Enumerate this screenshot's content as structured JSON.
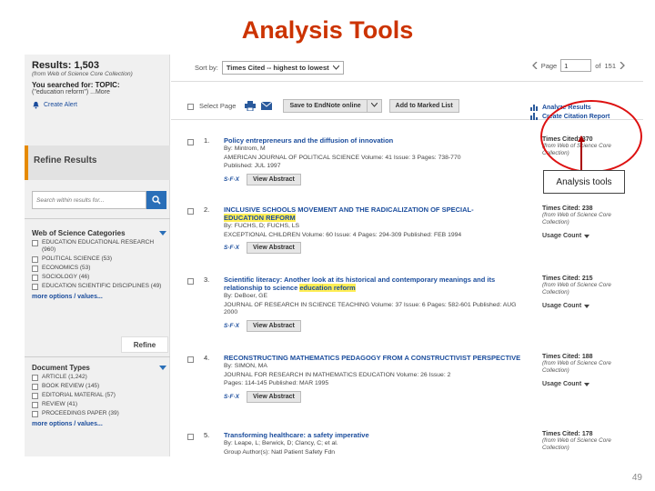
{
  "slide": {
    "title": "Analysis Tools",
    "page_number": "49"
  },
  "sidebar": {
    "results_title": "Results: 1,503",
    "results_note": "(from Web of Science Core Collection)",
    "searched_label": "You searched for: TOPIC:",
    "searched_query": "(\"education reform\") ...More",
    "create_alert": "Create Alert",
    "refine_title": "Refine Results",
    "search_placeholder": "Search within results for...",
    "categories": {
      "title": "Web of Science Categories",
      "items": [
        "EDUCATION EDUCATIONAL RESEARCH (960)",
        "POLITICAL SCIENCE (53)",
        "ECONOMICS (53)",
        "SOCIOLOGY (46)",
        "EDUCATION SCIENTIFIC DISCIPLINES (49)"
      ],
      "more": "more options / values...",
      "refine": "Refine"
    },
    "doc_types": {
      "title": "Document Types",
      "items": [
        "ARTICLE (1,242)",
        "BOOK REVIEW (145)",
        "EDITORIAL MATERIAL (57)",
        "REVIEW (41)",
        "PROCEEDINGS PAPER (39)"
      ],
      "more": "more options / values..."
    }
  },
  "sortbar": {
    "label": "Sort by:",
    "value": "Times Cited -- highest to lowest",
    "page_label": "Page",
    "page_value": "1",
    "of_label": "of",
    "total_pages": "151"
  },
  "toolbar": {
    "select_page": "Select Page",
    "save_endnote": "Save to EndNote online",
    "add_marked": "Add to Marked List",
    "analyze": "Analyze Results",
    "citation_report": "Create Citation Report"
  },
  "records": [
    {
      "num": "1.",
      "title_parts": [
        "Policy entrepreneurs and the diffusion of innovation"
      ],
      "hl_index": -1,
      "by": "By: Mintrom, M",
      "journal": "AMERICAN JOURNAL OF POLITICAL SCIENCE   Volume: 41   Issue: 3   Pages: 738-770",
      "published": "Published: JUL 1997",
      "times_cited": "Times Cited: 370",
      "tc_note": "(from Web of Science Core Collection)"
    },
    {
      "num": "2.",
      "title_parts": [
        "INCLUSIVE SCHOOLS MOVEMENT AND THE RADICALIZATION OF SPECIAL-",
        "EDUCATION REFORM"
      ],
      "hl_index": 1,
      "by": "By: FUCHS, D; FUCHS, LS",
      "journal": "EXCEPTIONAL CHILDREN   Volume: 60   Issue: 4   Pages: 294-309   Published: FEB 1994",
      "published": "",
      "times_cited": "Times Cited: 238",
      "tc_note": "(from Web of Science Core Collection)",
      "usage": "Usage Count"
    },
    {
      "num": "3.",
      "title_parts": [
        "Scientific literacy: Another look at its historical and contemporary meanings and its relationship to science ",
        "education reform"
      ],
      "hl_index": 1,
      "by": "By: DeBoer, GE",
      "journal": "JOURNAL OF RESEARCH IN SCIENCE TEACHING   Volume: 37   Issue: 6   Pages: 582-601   Published: AUG 2000",
      "published": "",
      "times_cited": "Times Cited: 215",
      "tc_note": "(from Web of Science Core Collection)",
      "usage": "Usage Count"
    },
    {
      "num": "4.",
      "title_parts": [
        "RECONSTRUCTING MATHEMATICS PEDAGOGY FROM A CONSTRUCTIVIST PERSPECTIVE"
      ],
      "hl_index": -1,
      "by": "By: SIMON, MA",
      "journal": "JOURNAL FOR RESEARCH IN MATHEMATICS EDUCATION   Volume: 26   Issue: 2",
      "published": "Pages: 114-145   Published: MAR 1995",
      "times_cited": "Times Cited: 188",
      "tc_note": "(from Web of Science Core Collection)",
      "usage": "Usage Count"
    },
    {
      "num": "5.",
      "title_parts": [
        "Transforming healthcare: a safety imperative"
      ],
      "hl_index": -1,
      "by": "By: Leape, L; Berwick, D; Clancy, C; et al.",
      "journal": "Group Author(s): Natl Patient Safety Fdn",
      "published": "",
      "times_cited": "Times Cited: 178",
      "tc_note": "(from Web of Science Core Collection)"
    }
  ],
  "links": {
    "slink": "S·F·X",
    "view_abstract": "View Abstract"
  },
  "callout": {
    "label": "Analysis tools"
  }
}
